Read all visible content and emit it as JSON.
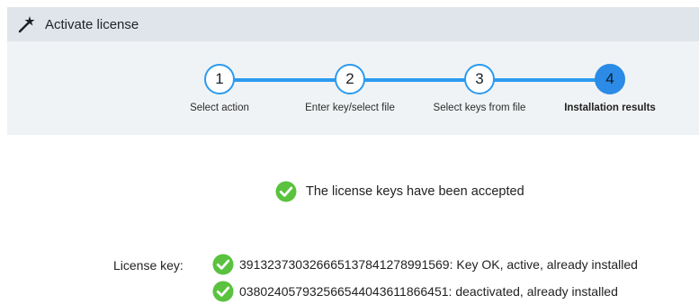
{
  "window": {
    "title": "Activate license",
    "icon": "magic-wand-icon"
  },
  "steps": [
    {
      "number": "1",
      "label": "Select action",
      "state": "completed"
    },
    {
      "number": "2",
      "label": "Enter key/select file",
      "state": "completed"
    },
    {
      "number": "3",
      "label": "Select keys from file",
      "state": "completed"
    },
    {
      "number": "4",
      "label": "Installation results",
      "state": "active"
    }
  ],
  "result": {
    "message": "The license keys have been accepted",
    "icon": "check-circle-icon"
  },
  "license": {
    "label": "License key:",
    "keys": [
      {
        "text": "3913237303266651378412789915​69: Key OK, active, already installed",
        "icon": "check-circle-icon"
      },
      {
        "text": "038024057932566544043611866451: deactivated, already installed",
        "icon": "check-circle-icon"
      }
    ]
  },
  "colors": {
    "accent": "#2b9bf0",
    "active_step": "#2b8be6",
    "success": "#5ac23e",
    "titlebar": "#dfe5ea",
    "steps_bg": "#f0f3f5"
  }
}
